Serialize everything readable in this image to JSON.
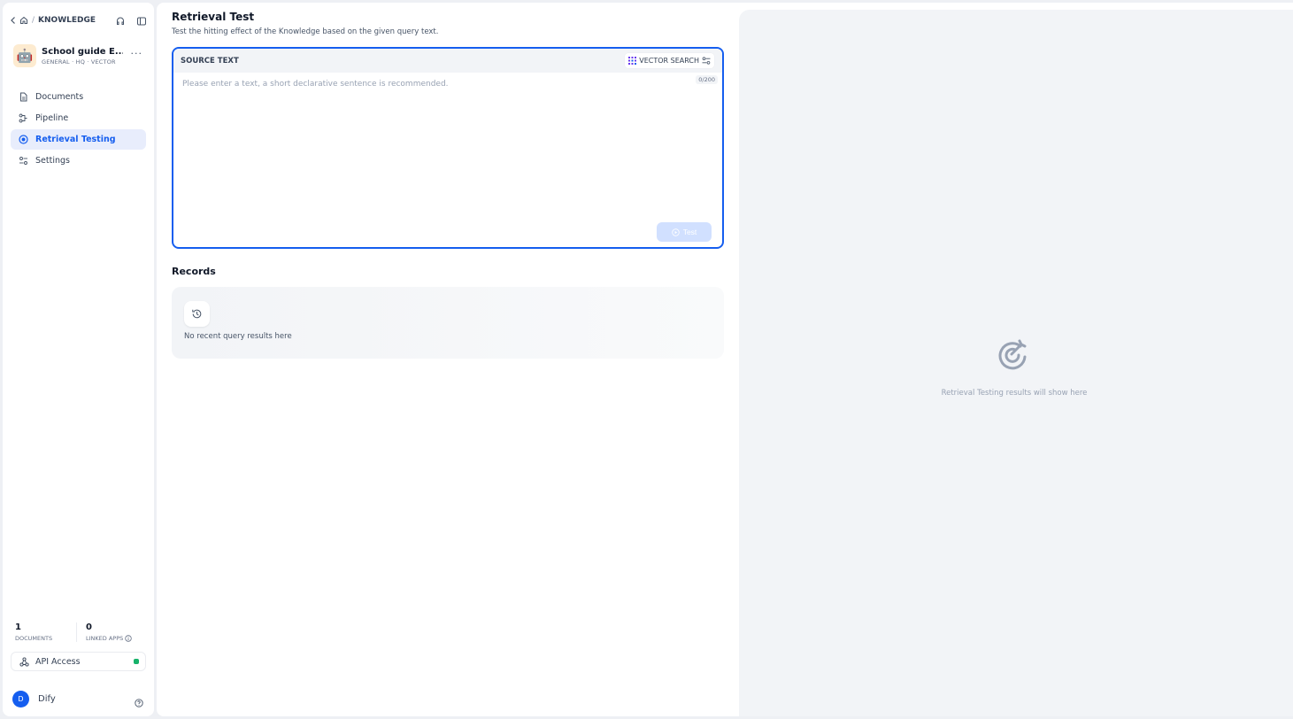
{
  "breadcrumb": {
    "section": "KNOWLEDGE"
  },
  "dataset": {
    "name": "School guide E...",
    "meta": "GENERAL · HQ · VECTOR",
    "avatar": "🤖"
  },
  "nav": {
    "documents": "Documents",
    "pipeline": "Pipeline",
    "retrieval": "Retrieval Testing",
    "settings": "Settings"
  },
  "stats": {
    "documents_value": "1",
    "documents_label": "DOCUMENTS",
    "apps_value": "0",
    "apps_label": "LINKED APPS"
  },
  "api": {
    "label": "API Access",
    "status_color": "#17b26a"
  },
  "user": {
    "initial": "D",
    "name": "Dify"
  },
  "page": {
    "title": "Retrieval Test",
    "description": "Test the hitting effect of the Knowledge based on the given query text."
  },
  "source": {
    "label": "SOURCE TEXT",
    "method": "VECTOR SEARCH",
    "placeholder": "Please enter a text, a short declarative sentence is recommended.",
    "value": "",
    "count": "0/200",
    "test_label": "Test"
  },
  "records": {
    "title": "Records",
    "empty": "No recent query results here"
  },
  "results": {
    "empty": "Retrieval Testing results will show here"
  },
  "colors": {
    "accent": "#155eef",
    "active_bg": "#e8edfc"
  }
}
